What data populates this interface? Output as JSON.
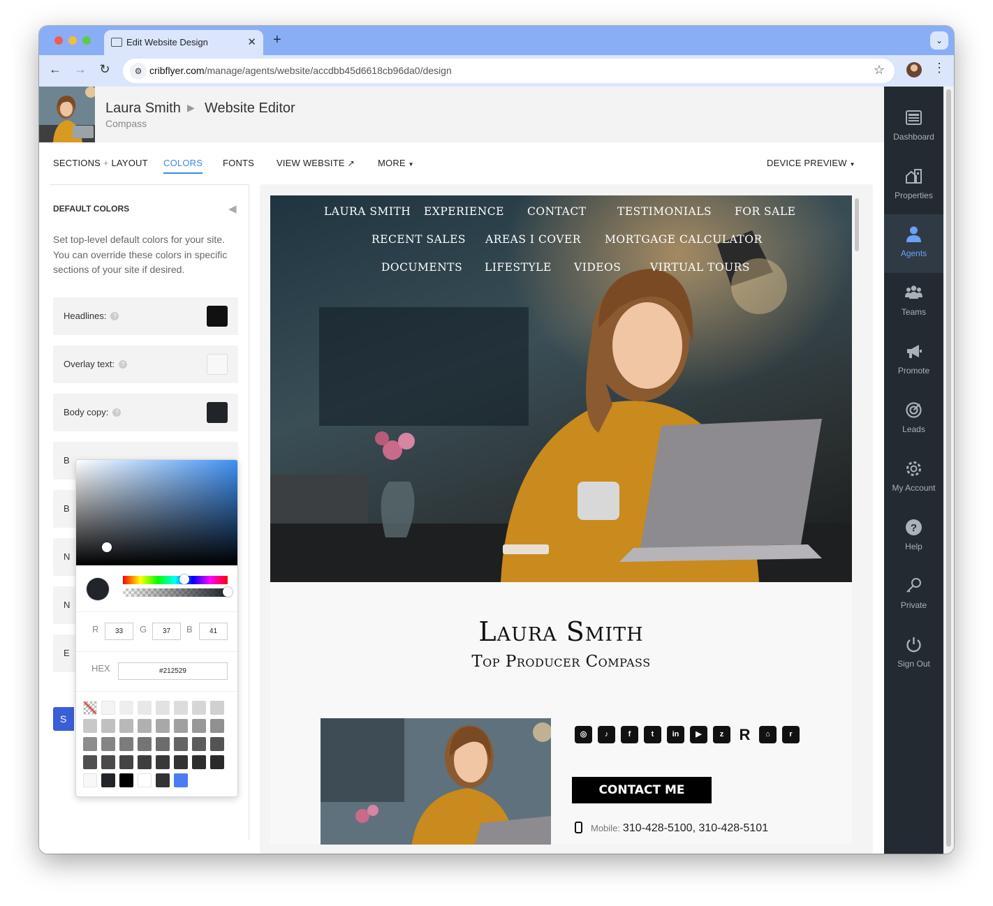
{
  "browser": {
    "tab_title": "Edit Website Design",
    "url_host": "cribflyer.com",
    "url_path": "/manage/agents/website/accdbb45d6618cb96da0/design"
  },
  "header": {
    "agent_name": "Laura Smith",
    "page_title": "Website Editor",
    "company": "Compass"
  },
  "menu": {
    "sections_a": "SECTIONS",
    "sections_plus": "+",
    "sections_b": "LAYOUT",
    "colors": "COLORS",
    "fonts": "FONTS",
    "view_website": "VIEW WEBSITE",
    "more": "MORE",
    "device_preview": "DEVICE PREVIEW"
  },
  "panel": {
    "title": "DEFAULT COLORS",
    "description": "Set top-level default colors for your site. You can override these colors in specific sections of your site if desired.",
    "rows": [
      {
        "label": "Headlines:",
        "color": "#111111"
      },
      {
        "label": "Overlay text:",
        "color": "#f8f8f8"
      },
      {
        "label": "Body copy:",
        "color": "#212529"
      }
    ],
    "hidden_row_letters": [
      "B",
      "B",
      "N",
      "N",
      "E"
    ],
    "save_label": "S"
  },
  "picker": {
    "r_label": "R",
    "g_label": "G",
    "b_label": "B",
    "r": "33",
    "g": "37",
    "b": "41",
    "hex_label": "HEX",
    "hex": "#212529",
    "palette": [
      [
        "none",
        "#f4f4f4",
        "#eeeeee",
        "#e8e8e8",
        "#e2e2e2",
        "#dcdcdc",
        "#d6d6d6",
        "#d0d0d0"
      ],
      [
        "#c8c8c8",
        "#c0c0c0",
        "#b8b8b8",
        "#b0b0b0",
        "#a8a8a8",
        "#a0a0a0",
        "#989898",
        "#909090"
      ],
      [
        "#8c8c8c",
        "#848484",
        "#7c7c7c",
        "#747474",
        "#6c6c6c",
        "#646464",
        "#5c5c5c",
        "#545454"
      ],
      [
        "#505050",
        "#4a4a4a",
        "#444444",
        "#3e3e3e",
        "#383838",
        "#333333",
        "#2e2e2e",
        "#2a2a2a"
      ],
      [
        "#f8f8f8",
        "#212529",
        "#000000",
        "#ffffff",
        "#333333",
        "#4a7cf5"
      ]
    ]
  },
  "site": {
    "nav": [
      "LAURA SMITH",
      "EXPERIENCE",
      "CONTACT",
      "TESTIMONIALS",
      "FOR SALE",
      "RECENT SALES",
      "AREAS I COVER",
      "MORTGAGE CALCULATOR",
      "DOCUMENTS",
      "LIFESTYLE",
      "VIDEOS",
      "VIRTUAL TOURS"
    ],
    "name": "Laura Smith",
    "subtitle": "Top Producer Compass",
    "contact_button": "CONTACT ME",
    "mobile_label": "Mobile:",
    "mobile_value": "310-428-5100, 310-428-5101"
  },
  "sidebar": {
    "items": [
      "Dashboard",
      "Properties",
      "Agents",
      "Teams",
      "Promote",
      "Leads",
      "My Account",
      "Help",
      "Private",
      "Sign Out"
    ],
    "active": "Agents"
  },
  "colors": {
    "accent": "#3a86f0",
    "sidebar_bg": "#232a31",
    "sidebar_active": "#6ea0f5"
  }
}
